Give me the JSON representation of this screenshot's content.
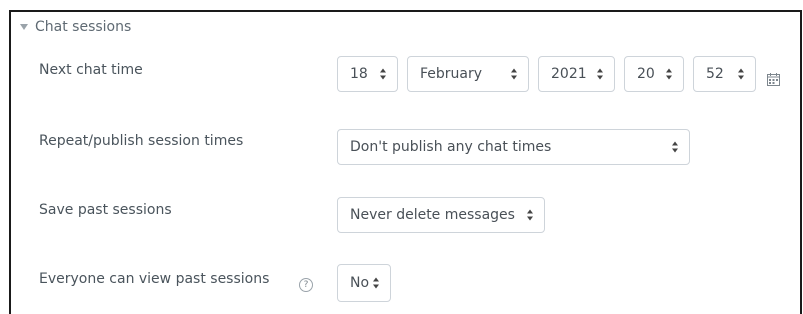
{
  "section": {
    "title": "Chat sessions"
  },
  "next_chat_time": {
    "label": "Next chat time",
    "day": "18",
    "month": "February",
    "year": "2021",
    "hour": "20",
    "minute": "52",
    "calendar_icon": "calendar-icon"
  },
  "repeat": {
    "label": "Repeat/publish session times",
    "value": "Don't publish any chat times"
  },
  "save_past": {
    "label": "Save past sessions",
    "value": "Never delete messages"
  },
  "everyone_view": {
    "label": "Everyone can view past sessions",
    "help_icon": "help-icon",
    "help_glyph": "?",
    "value": "No"
  },
  "colors": {
    "frame_border": "#1a1a1a",
    "select_border": "#ced4da",
    "text": "#495057",
    "muted": "#9aa3aa"
  }
}
